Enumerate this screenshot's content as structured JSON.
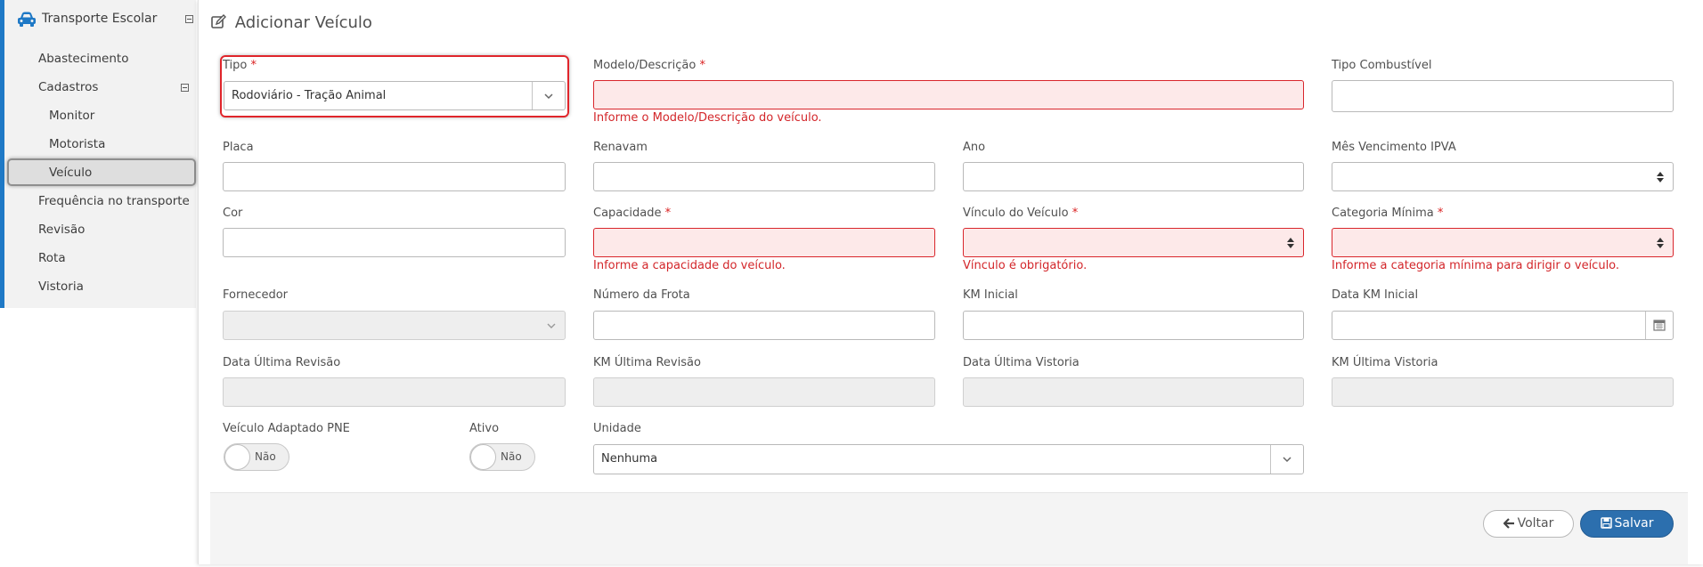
{
  "sidebar": {
    "module_title": "Transporte Escolar",
    "module_icon": "car-icon",
    "items": [
      {
        "label": "Abastecimento"
      },
      {
        "label": "Cadastros"
      },
      {
        "label": "Monitor"
      },
      {
        "label": "Motorista"
      },
      {
        "label": "Veículo"
      },
      {
        "label": "Frequência no transporte"
      },
      {
        "label": "Revisão"
      },
      {
        "label": "Rota"
      },
      {
        "label": "Vistoria"
      }
    ],
    "active_item": "Veículo",
    "accent_color": "#1f79c6"
  },
  "page": {
    "title": "Adicionar Veículo",
    "title_icon": "edit-icon"
  },
  "form": {
    "required_mark": "*",
    "tipo": {
      "label": "Tipo",
      "value": "Rodoviário - Tração Animal"
    },
    "modelo": {
      "label": "Modelo/Descrição",
      "value": "",
      "error": "Informe o Modelo/Descrição do veículo."
    },
    "tipo_combustivel": {
      "label": "Tipo Combustível",
      "value": ""
    },
    "placa": {
      "label": "Placa",
      "value": ""
    },
    "renavam": {
      "label": "Renavam",
      "value": ""
    },
    "ano": {
      "label": "Ano",
      "value": ""
    },
    "mes_ipva": {
      "label": "Mês Vencimento IPVA",
      "value": ""
    },
    "cor": {
      "label": "Cor",
      "value": ""
    },
    "capacidade": {
      "label": "Capacidade",
      "value": "",
      "error": "Informe a capacidade do veículo."
    },
    "vinculo": {
      "label": "Vínculo do Veículo",
      "value": "",
      "error": "Vínculo é obrigatório."
    },
    "categoria": {
      "label": "Categoria Mínima",
      "value": "",
      "error": "Informe a categoria mínima para dirigir o veículo."
    },
    "fornecedor": {
      "label": "Fornecedor",
      "value": ""
    },
    "numero_frota": {
      "label": "Número da Frota",
      "value": ""
    },
    "km_inicial": {
      "label": "KM Inicial",
      "value": ""
    },
    "data_km_inicial": {
      "label": "Data KM Inicial",
      "value": ""
    },
    "data_ultima_revisao": {
      "label": "Data Última Revisão",
      "value": ""
    },
    "km_ultima_revisao": {
      "label": "KM Última Revisão",
      "value": ""
    },
    "data_ultima_vistoria": {
      "label": "Data Última Vistoria",
      "value": ""
    },
    "km_ultima_vistoria": {
      "label": "KM Última Vistoria",
      "value": ""
    },
    "adaptado_pne": {
      "label": "Veículo Adaptado PNE",
      "value": "Não"
    },
    "ativo": {
      "label": "Ativo",
      "value": "Não"
    },
    "unidade": {
      "label": "Unidade",
      "value": "Nenhuma"
    }
  },
  "buttons": {
    "back": "Voltar",
    "save": "Salvar"
  },
  "colors": {
    "error": "#d3262a",
    "error_bg": "#fde9e9",
    "primary": "#2c6fae"
  }
}
